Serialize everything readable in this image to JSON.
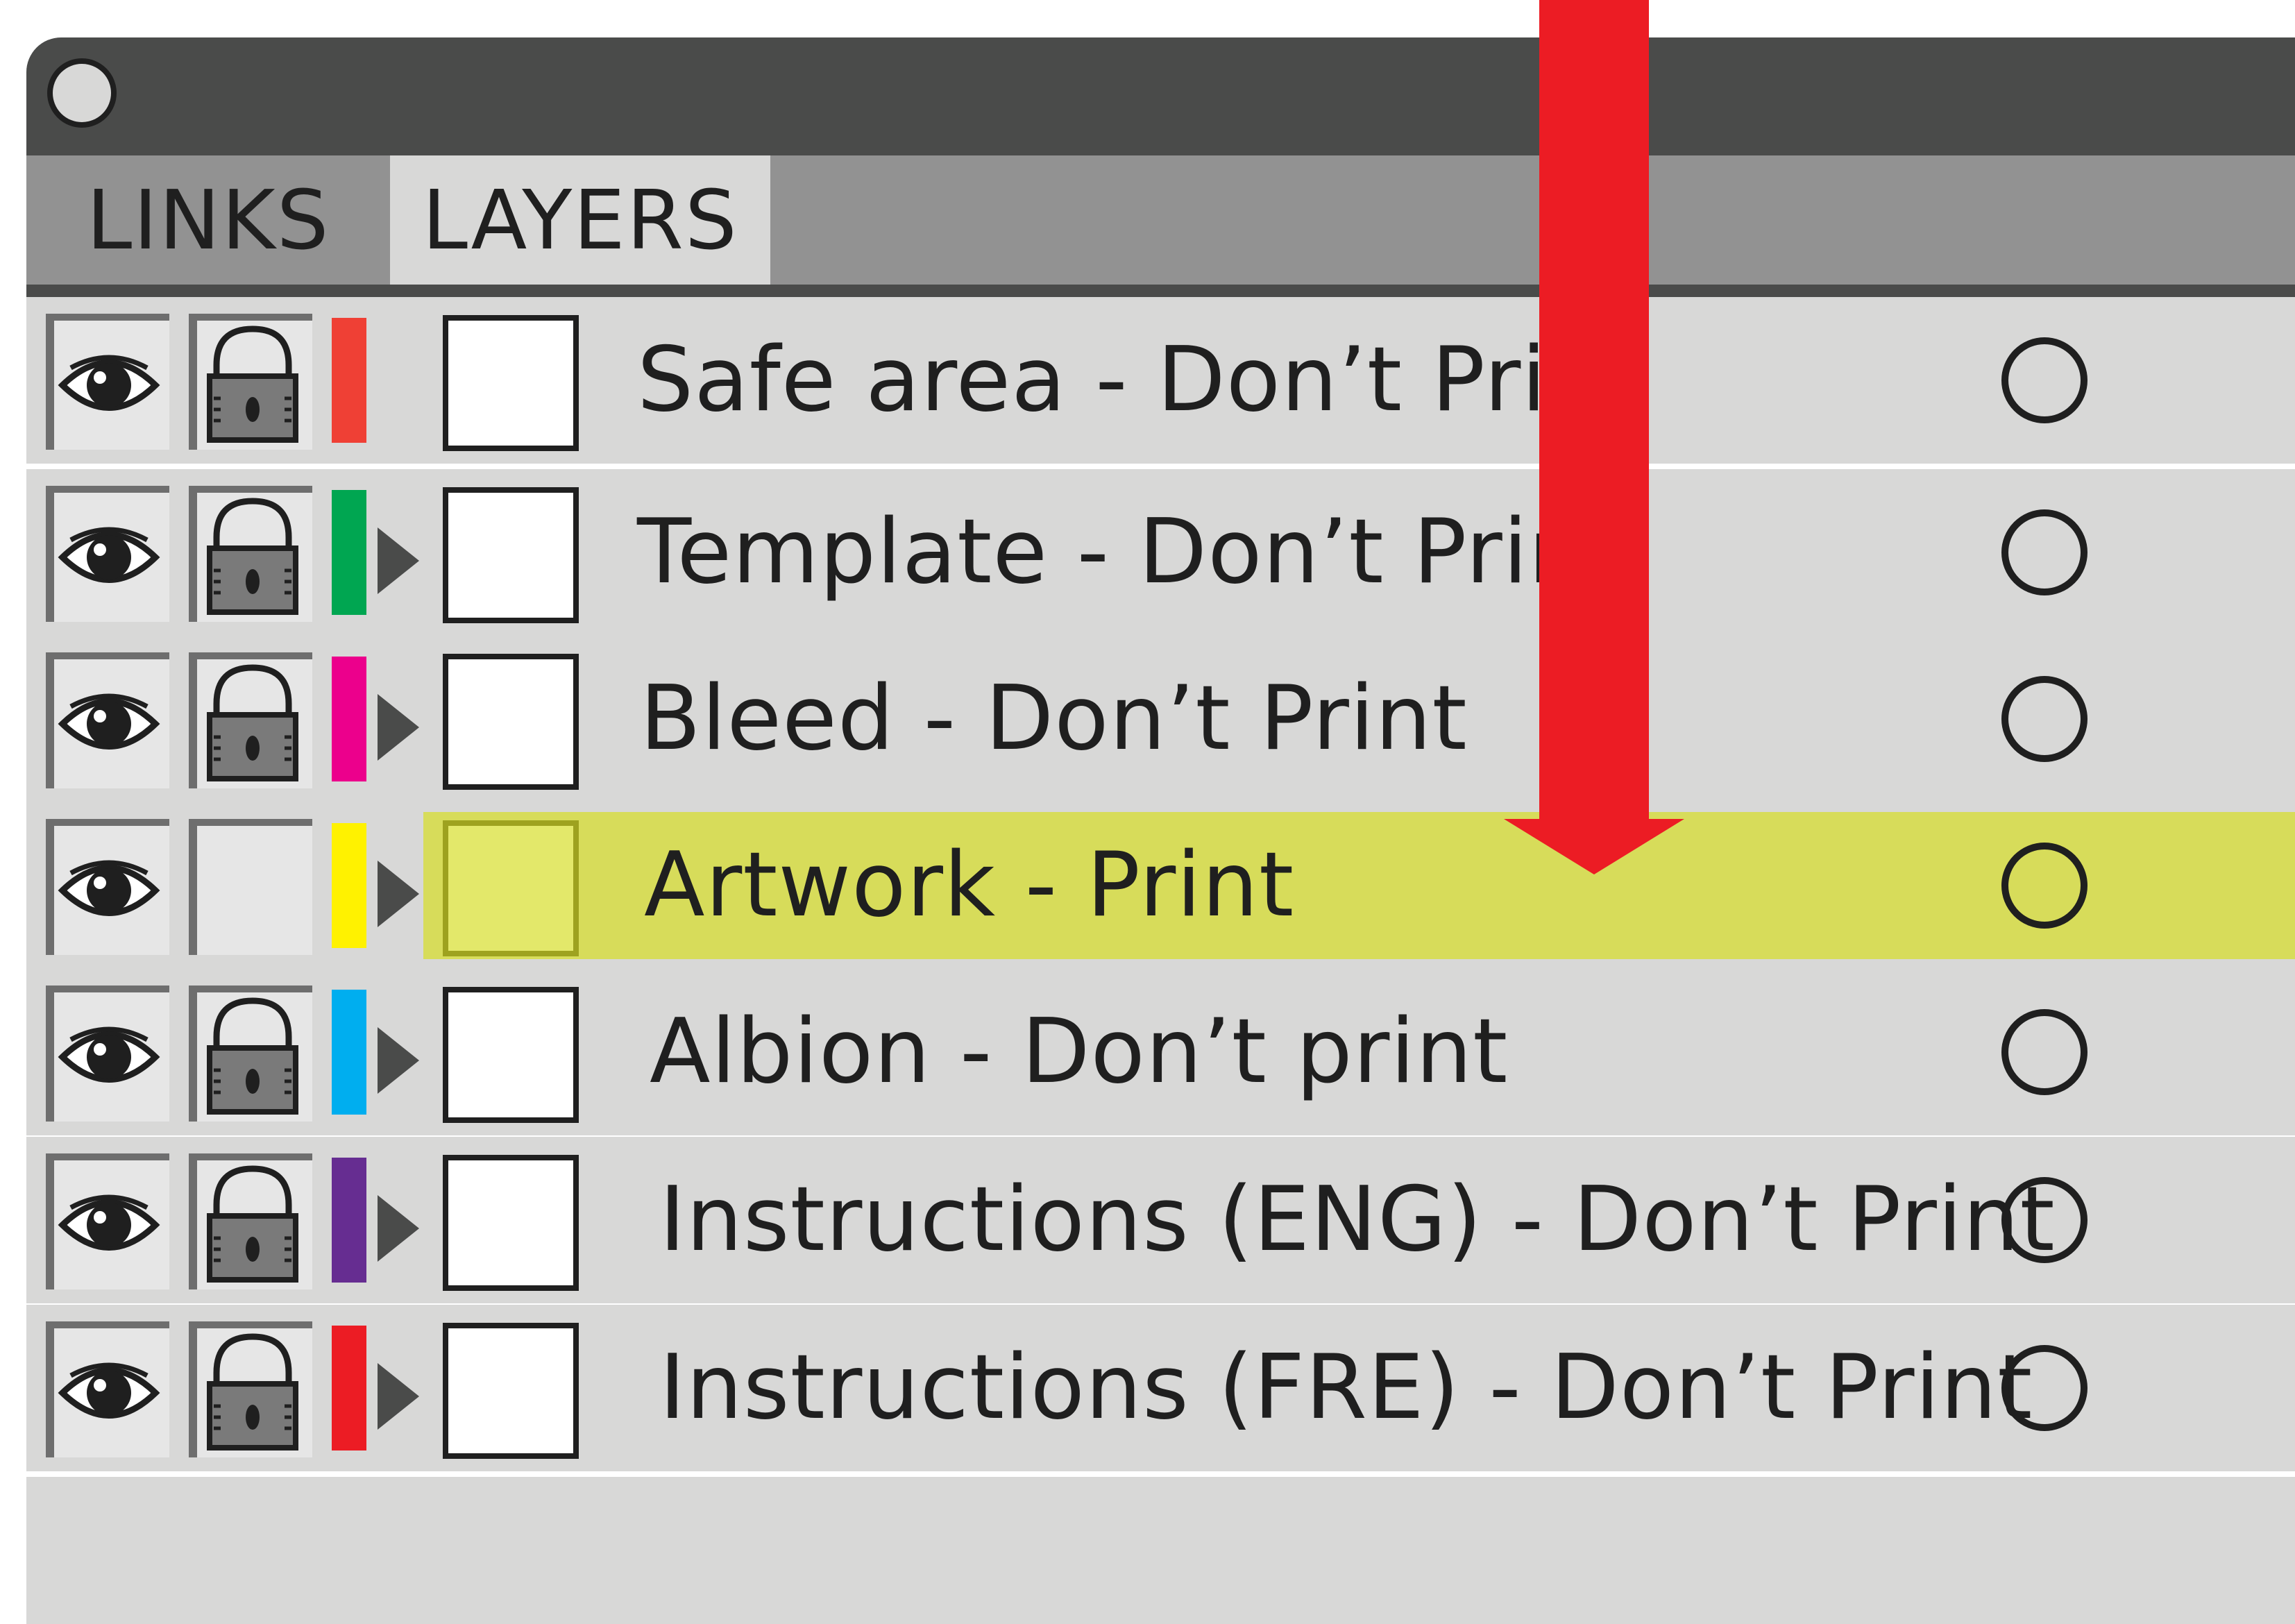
{
  "panel": {
    "tabs": [
      {
        "label": "LINKS",
        "active": false
      },
      {
        "label": "LAYERS",
        "active": true
      }
    ]
  },
  "layers": [
    {
      "name": "Safe area - Don’t Print",
      "color": "#ef4035",
      "visible": true,
      "locked": true,
      "expandable": false,
      "selected": false
    },
    {
      "name": "Template - Don’t Print",
      "color": "#00a651",
      "visible": true,
      "locked": true,
      "expandable": true,
      "selected": false
    },
    {
      "name": "Bleed - Don’t Print",
      "color": "#ec008c",
      "visible": true,
      "locked": true,
      "expandable": true,
      "selected": false
    },
    {
      "name": "Artwork - Print",
      "color": "#fff200",
      "visible": true,
      "locked": false,
      "expandable": true,
      "selected": true
    },
    {
      "name": "Albion - Don’t print",
      "color": "#00aeef",
      "visible": true,
      "locked": true,
      "expandable": true,
      "selected": false
    },
    {
      "name": "Instructions (ENG) - Don’t Print",
      "color": "#662d91",
      "visible": true,
      "locked": true,
      "expandable": true,
      "selected": false
    },
    {
      "name": "Instructions (FRE) - Don’t Print",
      "color": "#ec1c24",
      "visible": true,
      "locked": true,
      "expandable": true,
      "selected": false
    }
  ],
  "icons": {
    "visibility": "eye-icon",
    "lock": "lock-icon",
    "expand": "triangle-right-icon",
    "target": "circle-target-icon",
    "annotation": "arrow-down-icon"
  },
  "colors": {
    "titlebar": "#4a4b4a",
    "tabbar": "#929292",
    "panel": "#d8d8d7",
    "selection_highlight": "#d7dc5a",
    "annotation_arrow": "#ec1c24"
  }
}
